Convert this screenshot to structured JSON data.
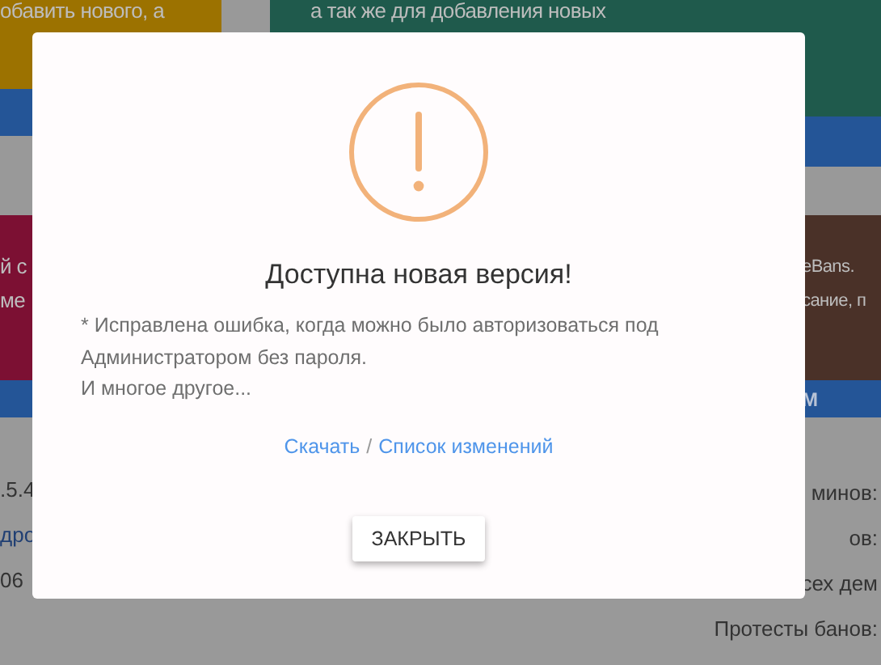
{
  "background": {
    "cards": [
      {
        "color": "#9c7200",
        "lines": [
          "обавить нового, а"
        ]
      },
      {
        "color": "#1f5a4c",
        "lines": [
          "а так же для добавления новых"
        ]
      }
    ],
    "cards_row_2": [
      {
        "color": "#7c1033",
        "lines": [
          "й с",
          "ме"
        ]
      },
      {
        "color": "#4a3128",
        "lines": [
          "eBans.",
          "сание, п"
        ],
        "footer": "М"
      }
    ],
    "left_texts": [
      {
        "text": ".5.4",
        "kind": "plain"
      },
      {
        "text": "дро",
        "kind": "link"
      },
      {
        "text": "06",
        "kind": "plain"
      }
    ],
    "right_texts": [
      "минов:",
      "ов:",
      "сех дем",
      "Протесты банов:"
    ]
  },
  "dialog": {
    "title": "Доступна новая версия!",
    "body": [
      "* Исправлена ошибка, когда можно было авторизоваться под Администратором без пароля.",
      "И многое другое..."
    ],
    "links": [
      "Скачать",
      "Список изменений"
    ],
    "separator": "/",
    "button": "ЗАКРЫТЬ"
  }
}
